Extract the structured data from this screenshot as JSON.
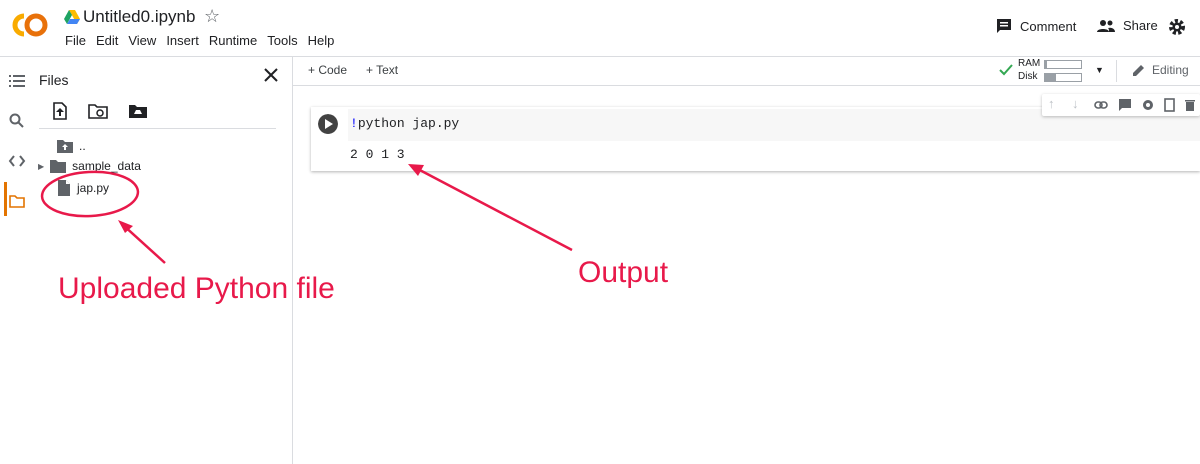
{
  "header": {
    "notebook_title": "Untitled0.ipynb",
    "menu": [
      "File",
      "Edit",
      "View",
      "Insert",
      "Runtime",
      "Tools",
      "Help"
    ],
    "comment_label": "Comment",
    "share_label": "Share"
  },
  "sidebar": {
    "title": "Files",
    "tree": [
      {
        "label": "..",
        "icon": "folder-up-icon"
      },
      {
        "label": "sample_data",
        "icon": "folder-icon"
      },
      {
        "label": "jap.py",
        "icon": "file-icon"
      }
    ]
  },
  "toolbar": {
    "code_label": "+ Code",
    "text_label": "+ Text",
    "ram_label": "RAM",
    "disk_label": "Disk",
    "ram_usage": 0.05,
    "disk_usage": 0.3,
    "editing_label": "Editing"
  },
  "cell": {
    "code_bang": "!",
    "code_rest": "python jap.py",
    "output": "2 0 1 3"
  },
  "annotations": {
    "file_note": "Uploaded Python file",
    "output_note": "Output"
  },
  "colors": {
    "annotation": "#e8194a",
    "accent": "#e37400",
    "check": "#34a853"
  }
}
